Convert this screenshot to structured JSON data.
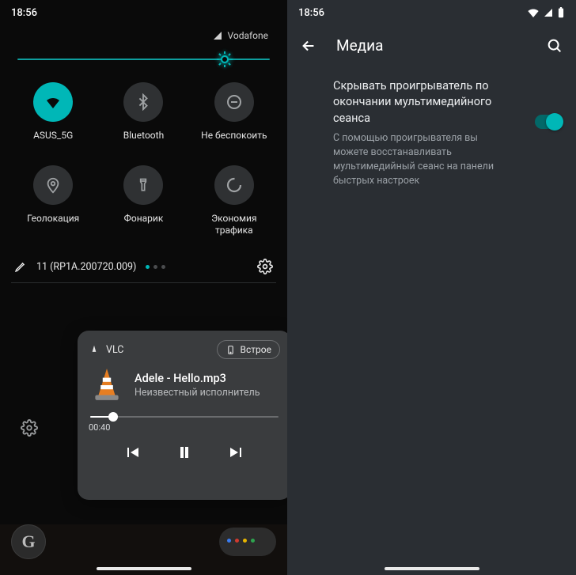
{
  "left": {
    "status_time": "18:56",
    "carrier": "Vodafone",
    "brightness_percent": 82,
    "tiles": [
      {
        "id": "wifi",
        "label": "ASUS_5G",
        "active": true
      },
      {
        "id": "bluetooth",
        "label": "Bluetooth",
        "active": false
      },
      {
        "id": "dnd",
        "label": "Не беспокоить",
        "active": false
      },
      {
        "id": "location",
        "label": "Геолокация",
        "active": false
      },
      {
        "id": "flashlight",
        "label": "Фонарик",
        "active": false
      },
      {
        "id": "datasaver",
        "label": "Экономия трафика",
        "active": false
      }
    ],
    "build_label": "11 (RP1A.200720.009)",
    "page_dots": {
      "count": 3,
      "active_index": 0
    },
    "media": {
      "app_name": "VLC",
      "output_label": "Встрое",
      "track_title": "Adele - Hello.mp3",
      "track_artist": "Неизвестный исполнитель",
      "elapsed": "00:40",
      "progress_percent": 12,
      "playing": true
    },
    "home_glyph": "G"
  },
  "right": {
    "status_time": "18:56",
    "header_title": "Медиа",
    "setting_title": "Скрывать проигрыватель по окончании мультимедийного сеанса",
    "setting_desc": "С помощью проигрывателя вы можете восстанавливать мультимедийный сеанс на панели быстрых настроек",
    "toggle_on": true
  },
  "colors": {
    "accent": "#00b7b7"
  }
}
